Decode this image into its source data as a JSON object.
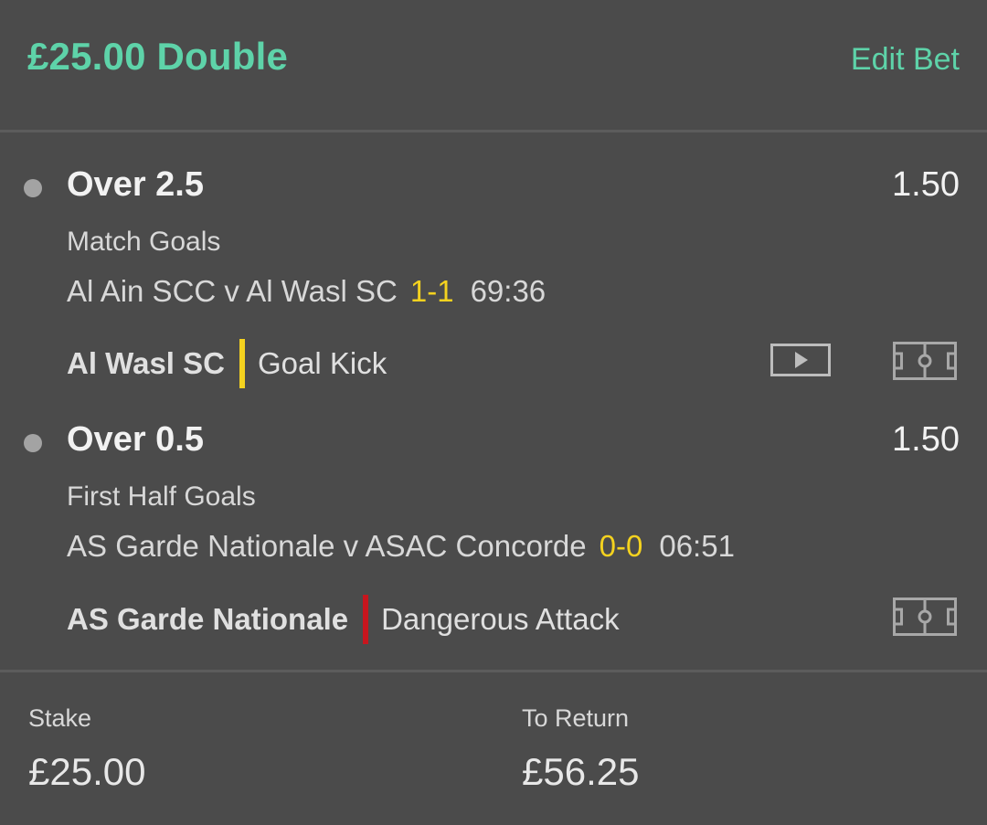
{
  "header": {
    "title": "£25.00 Double",
    "edit_label": "Edit Bet"
  },
  "selections": [
    {
      "name": "Over 2.5",
      "odds": "1.50",
      "market": "Match Goals",
      "event": "Al Ain SCC v Al Wasl SC",
      "score": "1-1",
      "clock": "69:36",
      "live_team": "Al Wasl SC",
      "live_action": "Goal Kick",
      "live_bar_color": "#f4d21f",
      "icons": [
        "video-icon",
        "pitch-icon"
      ]
    },
    {
      "name": "Over 0.5",
      "odds": "1.50",
      "market": "First Half Goals",
      "event": "AS Garde Nationale v ASAC Concorde",
      "score": "0-0",
      "clock": "06:51",
      "live_team": "AS Garde Nationale",
      "live_action": "Dangerous Attack",
      "live_bar_color": "#c7161e",
      "icons": [
        "pitch-icon"
      ]
    }
  ],
  "footer": {
    "stake_label": "Stake",
    "stake_value": "£25.00",
    "return_label": "To Return",
    "return_value": "£56.25"
  },
  "colors": {
    "accent": "#5ed3a9",
    "score": "#f4d21f",
    "background": "#4b4b4b"
  }
}
